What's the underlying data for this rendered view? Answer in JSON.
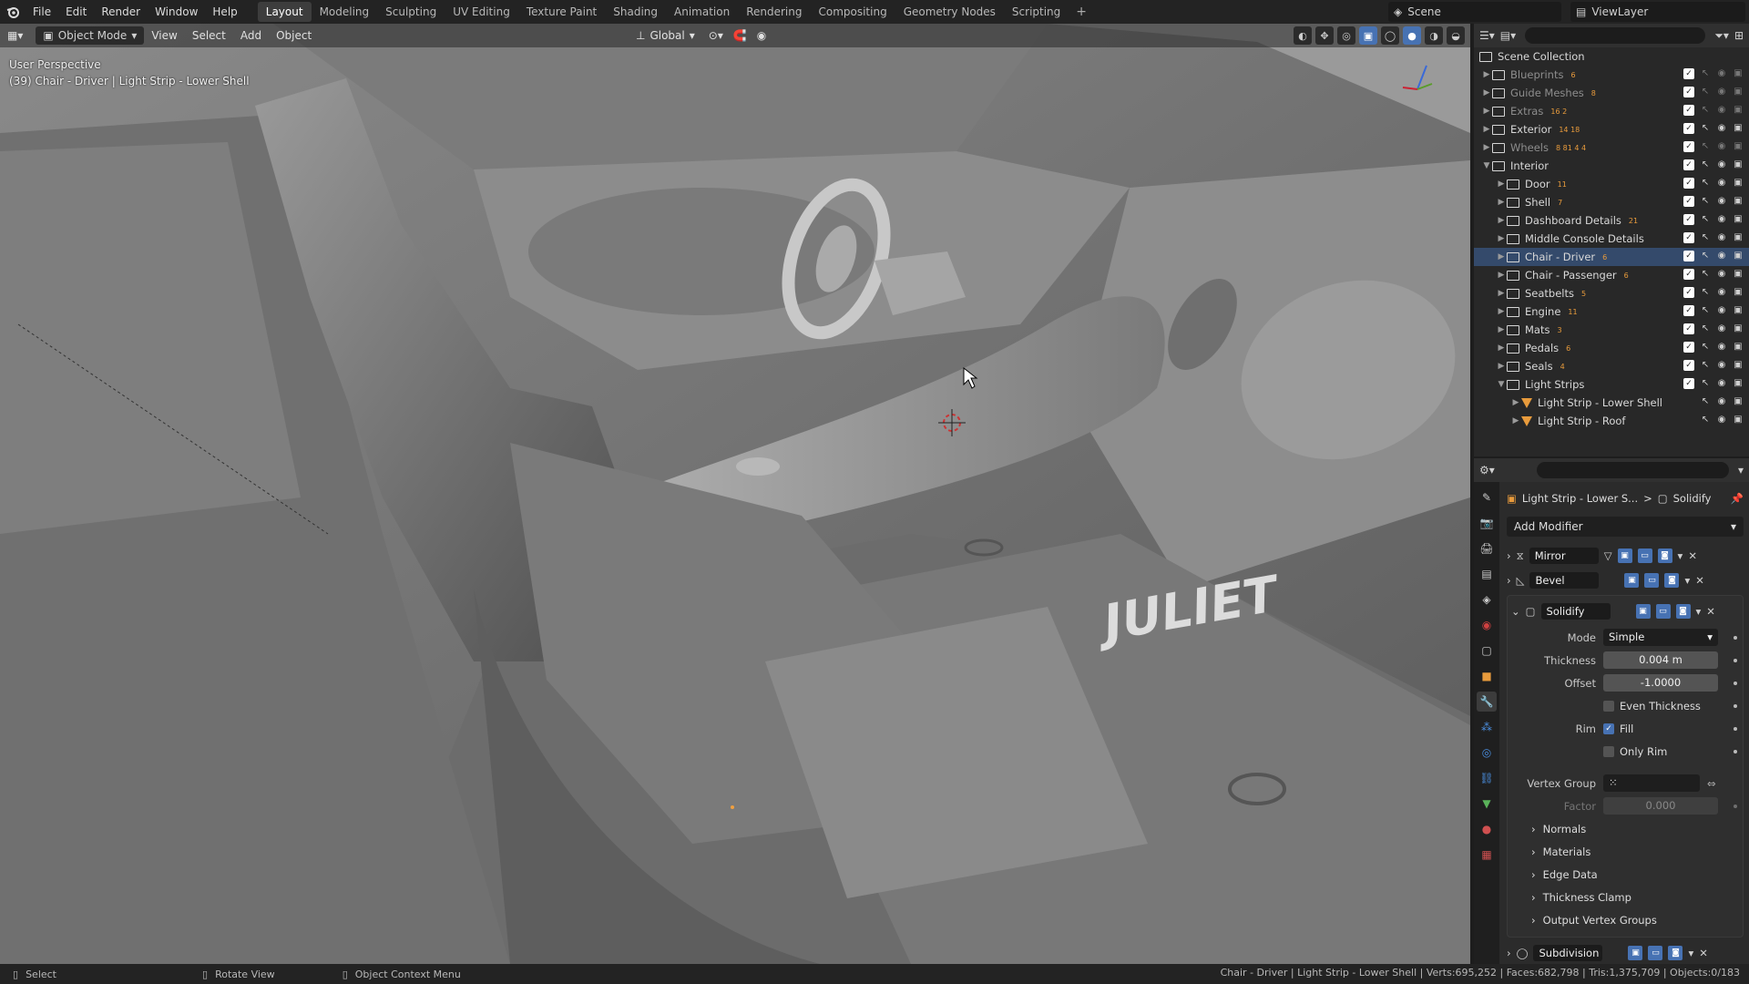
{
  "menu": {
    "file": "File",
    "edit": "Edit",
    "render": "Render",
    "window": "Window",
    "help": "Help"
  },
  "workspaces": [
    "Layout",
    "Modeling",
    "Sculpting",
    "UV Editing",
    "Texture Paint",
    "Shading",
    "Animation",
    "Rendering",
    "Compositing",
    "Geometry Nodes",
    "Scripting"
  ],
  "workspace_add": "+",
  "scene": "Scene",
  "view_layer": "ViewLayer",
  "viewport": {
    "mode": "Object Mode",
    "view": "View",
    "select": "Select",
    "add": "Add",
    "object": "Object",
    "transform_orientation": "Global",
    "perspective": "User Perspective",
    "active_info": "(39) Chair - Driver | Light Strip - Lower Shell",
    "emblem_text": "JULIET"
  },
  "outliner": {
    "root": "Scene Collection",
    "rows": [
      {
        "name": "Blueprints",
        "badge": "6"
      },
      {
        "name": "Guide Meshes",
        "badge": "8"
      },
      {
        "name": "Extras",
        "badge": "16 2"
      },
      {
        "name": "Exterior",
        "badge": "14 18"
      },
      {
        "name": "Wheels",
        "badge": "8 81 4 4"
      },
      {
        "name": "Interior",
        "badge": ""
      },
      {
        "name": "Door",
        "badge": "11"
      },
      {
        "name": "Shell",
        "badge": "7"
      },
      {
        "name": "Dashboard Details",
        "badge": "21"
      },
      {
        "name": "Middle Console Details",
        "badge": ""
      },
      {
        "name": "Chair - Driver",
        "badge": "6"
      },
      {
        "name": "Chair - Passenger",
        "badge": "6"
      },
      {
        "name": "Seatbelts",
        "badge": "5"
      },
      {
        "name": "Engine",
        "badge": "11"
      },
      {
        "name": "Mats",
        "badge": "3"
      },
      {
        "name": "Pedals",
        "badge": "6"
      },
      {
        "name": "Seals",
        "badge": "4"
      },
      {
        "name": "Light Strips",
        "badge": ""
      },
      {
        "name": "Light Strip - Lower Shell",
        "badge": ""
      },
      {
        "name": "Light Strip - Roof",
        "badge": ""
      }
    ]
  },
  "properties": {
    "object_name": "Light Strip - Lower S...",
    "crumb_sep": ">",
    "modifier_crumb": "Solidify",
    "add_modifier": "Add Modifier",
    "modifiers": [
      "Mirror",
      "Bevel",
      "Solidify",
      "Subdivision"
    ],
    "solidify": {
      "mode_label": "Mode",
      "mode_value": "Simple",
      "thickness_label": "Thickness",
      "thickness_value": "0.004 m",
      "offset_label": "Offset",
      "offset_value": "-1.0000",
      "even_thickness": "Even Thickness",
      "rim_label": "Rim",
      "fill": "Fill",
      "only_rim": "Only Rim",
      "vertex_group_label": "Vertex Group",
      "factor_label": "Factor",
      "factor_value": "0.000",
      "subpanels": [
        "Normals",
        "Materials",
        "Edge Data",
        "Thickness Clamp",
        "Output Vertex Groups"
      ]
    }
  },
  "statusbar": {
    "select": "Select",
    "rotate": "Rotate View",
    "context": "Object Context Menu",
    "stats": "Chair - Driver | Light Strip - Lower Shell | Verts:695,252 | Faces:682,798 | Tris:1,375,709 | Objects:0/183"
  },
  "colors": {
    "accent": "#4772b3",
    "header": "#232323",
    "panel": "#2b2b2b",
    "mesh_icon": "#e89b3c"
  }
}
